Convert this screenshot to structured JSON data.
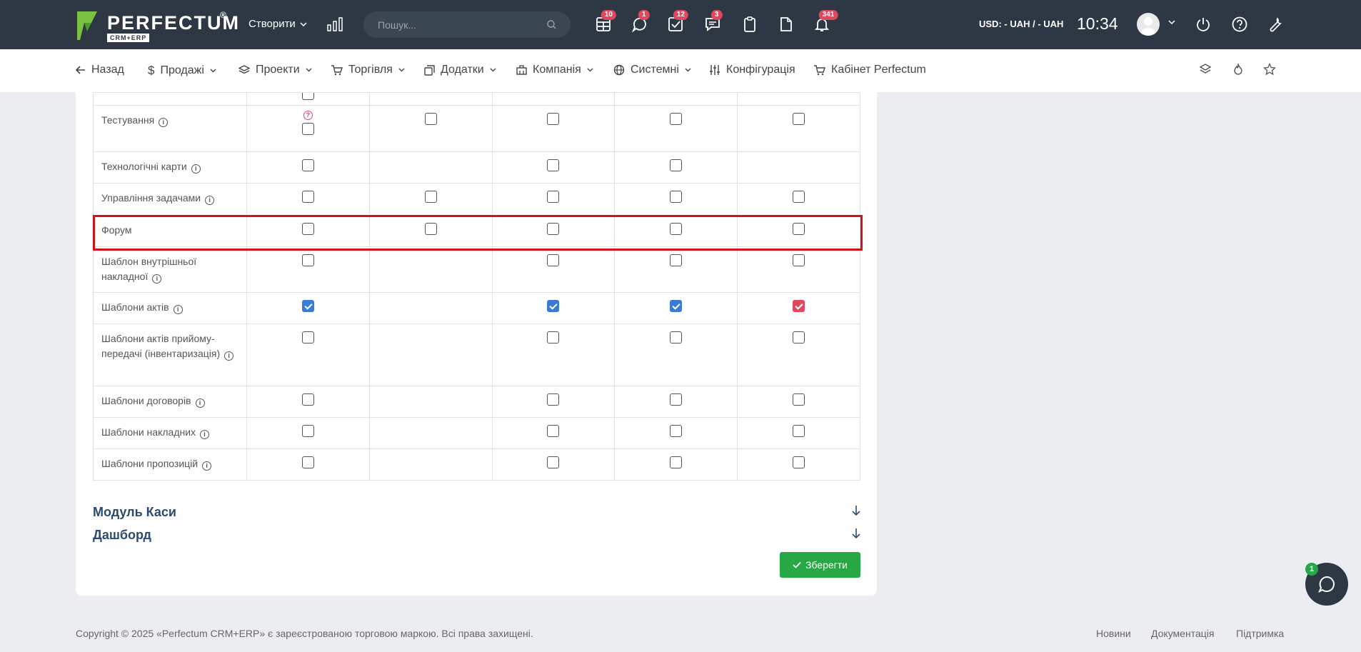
{
  "header": {
    "logo_text": "PERFECTUM",
    "logo_sub": "CRM+ERP",
    "logo_reg": "®",
    "create_label": "Створити",
    "search_placeholder": "Пошук...",
    "badges": {
      "tables": "10",
      "chat": "1",
      "tasks": "12",
      "messages": "3",
      "notifications": "341"
    },
    "currency": "USD: - UAH / - UAH",
    "time": "10:34"
  },
  "nav": {
    "back": "Назад",
    "sales": "Продажі",
    "projects": "Проекти",
    "trade": "Торгівля",
    "addons": "Додатки",
    "company": "Компанія",
    "system": "Системні",
    "config": "Конфігурація",
    "cabinet": "Кабінет Perfectum"
  },
  "rows": [
    {
      "name": "Тестування",
      "info": true,
      "checks": [
        "qoff",
        "off",
        "off",
        "off",
        "off"
      ]
    },
    {
      "name": "Технологічні карти",
      "info": true,
      "checks": [
        "off",
        "",
        "off",
        "off",
        ""
      ]
    },
    {
      "name": "Управління задачами",
      "info": true,
      "checks": [
        "off",
        "off",
        "off",
        "off",
        "off"
      ]
    },
    {
      "name": "Форум",
      "info": false,
      "checks": [
        "off",
        "off",
        "off",
        "off",
        "off"
      ]
    },
    {
      "name": "Шаблон внутрішньої накладної",
      "info": true,
      "checks": [
        "off",
        "",
        "off",
        "off",
        "off"
      ]
    },
    {
      "name": "Шаблони актів",
      "info": true,
      "checks": [
        "blue",
        "",
        "blue",
        "blue",
        "red"
      ]
    },
    {
      "name": "Шаблони актів прийому-передачі (інвентаризація)",
      "info": true,
      "checks": [
        "off",
        "",
        "off",
        "off",
        "off"
      ]
    },
    {
      "name": "Шаблони договорів",
      "info": true,
      "checks": [
        "off",
        "",
        "off",
        "off",
        "off"
      ]
    },
    {
      "name": "Шаблони накладних",
      "info": true,
      "checks": [
        "off",
        "",
        "off",
        "off",
        "off"
      ]
    },
    {
      "name": "Шаблони пропозицій",
      "info": true,
      "checks": [
        "off",
        "",
        "off",
        "off",
        "off"
      ]
    }
  ],
  "sections": {
    "cash": "Модуль Каси",
    "dashboard": "Дашборд"
  },
  "save_label": "Зберегти",
  "footer": {
    "copyright": "Copyright © 2025 «Perfectum CRM+ERP» є зареєстрованою торговою маркою. Всі права захищені.",
    "news": "Новини",
    "docs": "Документація",
    "support": "Підтримка"
  },
  "chat_badge": "1",
  "colors": {
    "accent": "#2d3844",
    "checked_blue": "#3a7bd5",
    "checked_red": "#e0485e",
    "save": "#28a745",
    "highlight": "#d0121b"
  }
}
